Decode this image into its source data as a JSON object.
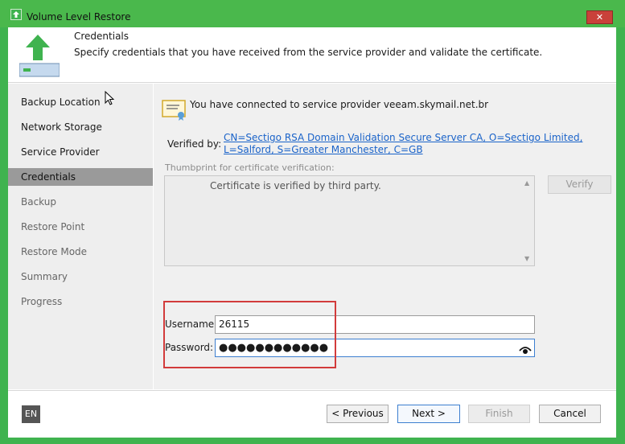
{
  "window": {
    "title": "Volume Level Restore",
    "close_glyph": "✕",
    "accent_color": "#4ab84c"
  },
  "header": {
    "title": "Credentials",
    "description": "Specify credentials that you have received from the service provider and validate the certificate."
  },
  "sidebar": {
    "items": [
      {
        "label": "Backup Location",
        "state": "normal"
      },
      {
        "label": "Network Storage",
        "state": "normal"
      },
      {
        "label": "Service Provider",
        "state": "normal"
      },
      {
        "label": "Credentials",
        "state": "active"
      },
      {
        "label": "Backup",
        "state": "disabled"
      },
      {
        "label": "Restore Point",
        "state": "disabled"
      },
      {
        "label": "Restore Mode",
        "state": "disabled"
      },
      {
        "label": "Summary",
        "state": "disabled"
      },
      {
        "label": "Progress",
        "state": "disabled"
      }
    ]
  },
  "main": {
    "connected_text": "You have connected to service provider veeam.skymail.net.br",
    "verified_by_label": "Verified by:",
    "verified_by_value": "CN=Sectigo RSA Domain Validation Secure Server CA, O=Sectigo Limited, L=Salford, S=Greater Manchester, C=GB",
    "thumbprint_label": "Thumbprint for certificate verification:",
    "thumbprint_text": "Certificate is verified by third party.",
    "verify_button": "Verify",
    "username_label": "Username:",
    "username_value": "26115",
    "password_label": "Password:",
    "password_value": "●●●●●●●●●●●●"
  },
  "footer": {
    "language": "EN",
    "previous_button": "< Previous",
    "next_button": "Next >",
    "finish_button": "Finish",
    "cancel_button": "Cancel"
  }
}
